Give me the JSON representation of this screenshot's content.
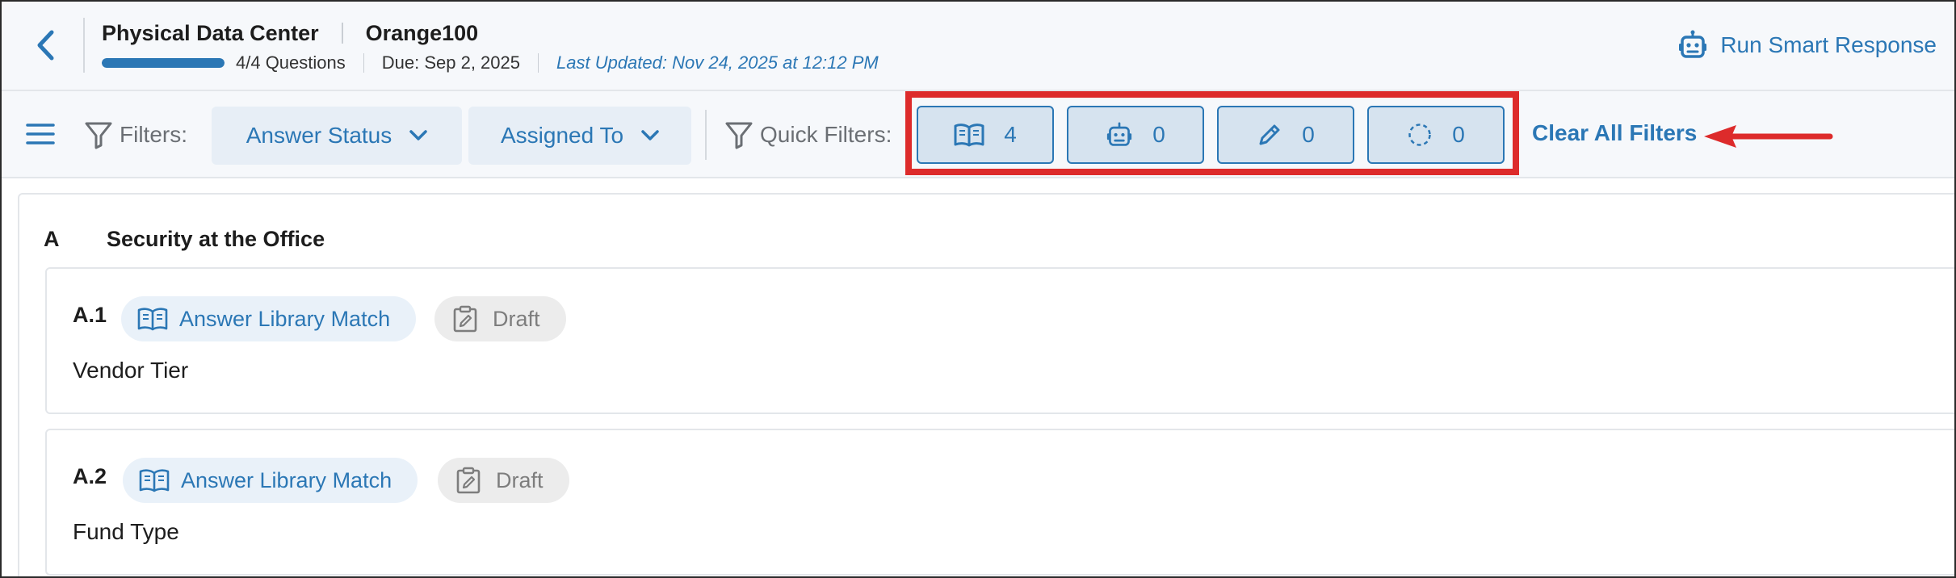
{
  "header": {
    "title": "Physical Data Center",
    "subtitle": "Orange100",
    "progress_fraction": 1.0,
    "questions_count": "4/4 Questions",
    "due": "Due: Sep 2, 2025",
    "last_updated": "Last Updated: Nov 24, 2025 at 12:12 PM",
    "smart_response_label": "Run Smart Response"
  },
  "filters": {
    "label": "Filters:",
    "answer_status": "Answer Status",
    "assigned_to": "Assigned To",
    "quick_label": "Quick Filters:",
    "quick": [
      {
        "icon": "book-icon",
        "count": "4"
      },
      {
        "icon": "robot-icon",
        "count": "0"
      },
      {
        "icon": "pencil-icon",
        "count": "0"
      },
      {
        "icon": "dashed-circle-icon",
        "count": "0"
      }
    ],
    "clear_label": "Clear All Filters"
  },
  "section": {
    "letter": "A",
    "title": "Security at the Office"
  },
  "questions": [
    {
      "number": "A.1",
      "match_label": "Answer Library Match",
      "status_label": "Draft",
      "text": "Vendor Tier"
    },
    {
      "number": "A.2",
      "match_label": "Answer Library Match",
      "status_label": "Draft",
      "text": "Fund Type"
    }
  ],
  "colors": {
    "accent": "#2b77b5",
    "highlight": "#dd2b2b",
    "chip_bg": "#d6e3ef"
  }
}
